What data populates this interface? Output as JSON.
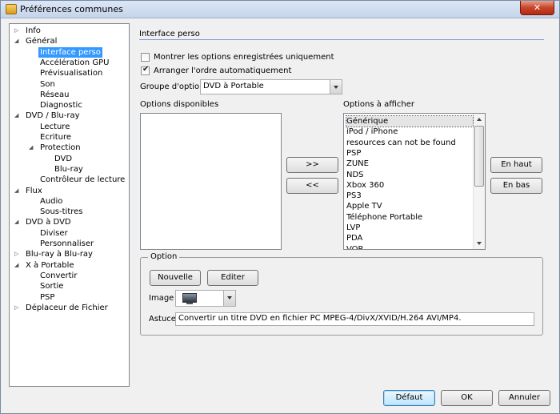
{
  "window": {
    "title": "Préférences communes",
    "close_label": "✕"
  },
  "tree": {
    "items": [
      {
        "label": "Info",
        "expander": "▷"
      },
      {
        "label": "Général",
        "expander": "◢"
      },
      {
        "label": "Interface perso",
        "expander": "",
        "selected": true
      },
      {
        "label": "Accélération GPU",
        "expander": ""
      },
      {
        "label": "Prévisualisation",
        "expander": ""
      },
      {
        "label": "Son",
        "expander": ""
      },
      {
        "label": "Réseau",
        "expander": ""
      },
      {
        "label": "Diagnostic",
        "expander": ""
      },
      {
        "label": "DVD / Blu-ray",
        "expander": "◢"
      },
      {
        "label": "Lecture",
        "expander": ""
      },
      {
        "label": "Ecriture",
        "expander": ""
      },
      {
        "label": "Protection",
        "expander": "◢"
      },
      {
        "label": "DVD",
        "expander": ""
      },
      {
        "label": "Blu-ray",
        "expander": ""
      },
      {
        "label": "Contrôleur de lecture",
        "expander": ""
      },
      {
        "label": "Flux",
        "expander": "◢"
      },
      {
        "label": "Audio",
        "expander": ""
      },
      {
        "label": "Sous-titres",
        "expander": ""
      },
      {
        "label": "DVD à DVD",
        "expander": "◢"
      },
      {
        "label": "Diviser",
        "expander": ""
      },
      {
        "label": "Personnaliser",
        "expander": ""
      },
      {
        "label": "Blu-ray à Blu-ray",
        "expander": "▷"
      },
      {
        "label": "X à Portable",
        "expander": "◢"
      },
      {
        "label": "Convertir",
        "expander": ""
      },
      {
        "label": "Sortie",
        "expander": ""
      },
      {
        "label": "PSP",
        "expander": ""
      },
      {
        "label": "Déplaceur de Fichier",
        "expander": "▷"
      }
    ]
  },
  "panel": {
    "title": "Interface perso",
    "show_saved_label": "Montrer les options enregistrées uniquement",
    "show_saved_checked": false,
    "auto_order_label": "Arranger l'ordre automatiquement",
    "auto_order_checked": true,
    "group_label": "Groupe d'options",
    "group_value": "DVD à Portable",
    "available_label": "Options disponibles",
    "display_label": "Options à afficher",
    "display_items": [
      "Générique",
      "iPod / iPhone",
      "resources can not be found",
      "PSP",
      "ZUNE",
      "NDS",
      "Xbox 360",
      "PS3",
      "Apple TV",
      "Téléphone Portable",
      "LVP",
      "PDA",
      "VOP"
    ],
    "move_right_label": ">>",
    "move_left_label": "<<",
    "move_up_label": "En haut",
    "move_down_label": "En bas"
  },
  "option_group": {
    "title": "Option",
    "new_label": "Nouvelle",
    "edit_label": "Editer",
    "image_label": "Image",
    "tip_label": "Astuce",
    "tip_value": "Convertir un titre DVD en fichier PC MPEG-4/DivX/XVID/H.264 AVI/MP4."
  },
  "footer": {
    "default_label": "Défaut",
    "ok_label": "OK",
    "cancel_label": "Annuler"
  }
}
